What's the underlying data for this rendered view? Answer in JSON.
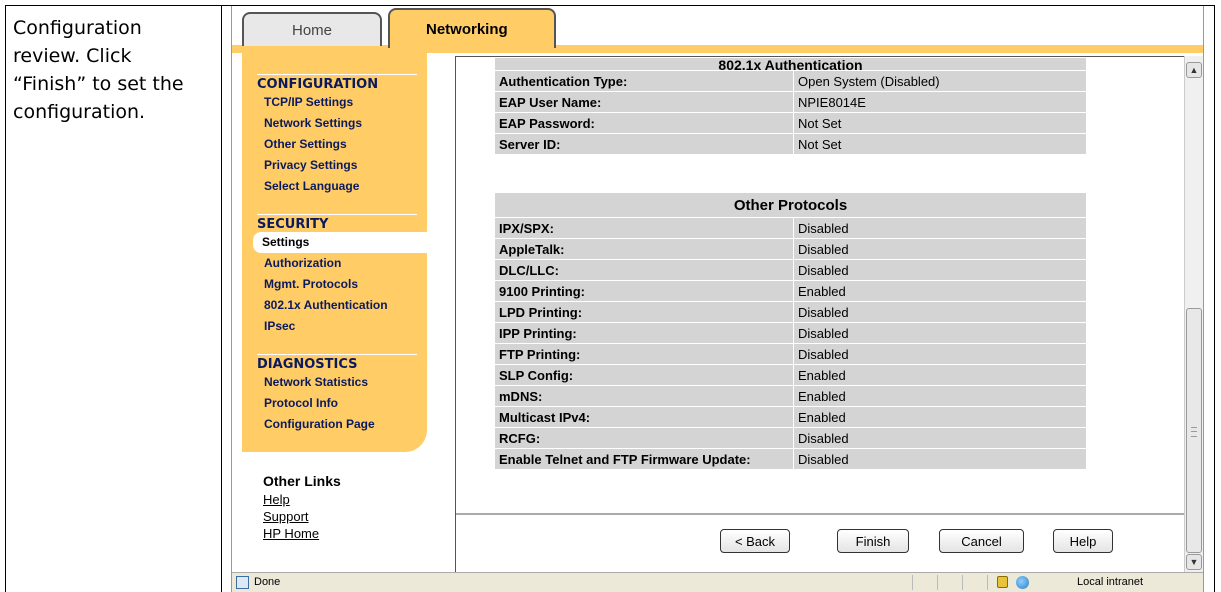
{
  "caption": "Configuration review.  Click “Finish” to set the configuration.",
  "tabs": {
    "home": "Home",
    "networking": "Networking"
  },
  "sidebar": {
    "configuration": {
      "title": "CONFIGURATION",
      "items": [
        "TCP/IP Settings",
        "Network Settings",
        "Other Settings",
        "Privacy Settings",
        "Select Language"
      ]
    },
    "security": {
      "title": "SECURITY",
      "items": [
        "Settings",
        "Authorization",
        "Mgmt. Protocols",
        "802.1x Authentication",
        "IPsec"
      ],
      "active": "Settings"
    },
    "diagnostics": {
      "title": "DIAGNOSTICS",
      "items": [
        "Network Statistics",
        "Protocol Info",
        "Configuration Page"
      ]
    }
  },
  "other_links": {
    "title": "Other Links",
    "links": [
      "Help",
      "Support",
      "HP Home"
    ]
  },
  "auth_table": {
    "header": "802.1x Authentication",
    "rows": [
      {
        "k": "Authentication Type:",
        "v": "Open System (Disabled)"
      },
      {
        "k": "EAP User Name:",
        "v": "NPIE8014E"
      },
      {
        "k": "EAP Password:",
        "v": "Not Set"
      },
      {
        "k": "Server ID:",
        "v": "Not Set"
      }
    ]
  },
  "protocols_table": {
    "header": "Other Protocols",
    "rows": [
      {
        "k": "IPX/SPX:",
        "v": "Disabled"
      },
      {
        "k": "AppleTalk:",
        "v": "Disabled"
      },
      {
        "k": "DLC/LLC:",
        "v": "Disabled"
      },
      {
        "k": "9100 Printing:",
        "v": "Enabled"
      },
      {
        "k": "LPD Printing:",
        "v": "Disabled"
      },
      {
        "k": "IPP Printing:",
        "v": "Disabled"
      },
      {
        "k": "FTP Printing:",
        "v": "Disabled"
      },
      {
        "k": "SLP Config:",
        "v": "Enabled"
      },
      {
        "k": "mDNS:",
        "v": "Enabled"
      },
      {
        "k": "Multicast IPv4:",
        "v": "Enabled"
      },
      {
        "k": "RCFG:",
        "v": "Disabled"
      },
      {
        "k": "Enable Telnet and FTP Firmware Update:",
        "v": "Disabled"
      }
    ]
  },
  "buttons": {
    "back": "< Back",
    "finish": "Finish",
    "cancel": "Cancel",
    "help": "Help"
  },
  "statusbar": {
    "status": "Done",
    "zone": "Local intranet"
  }
}
